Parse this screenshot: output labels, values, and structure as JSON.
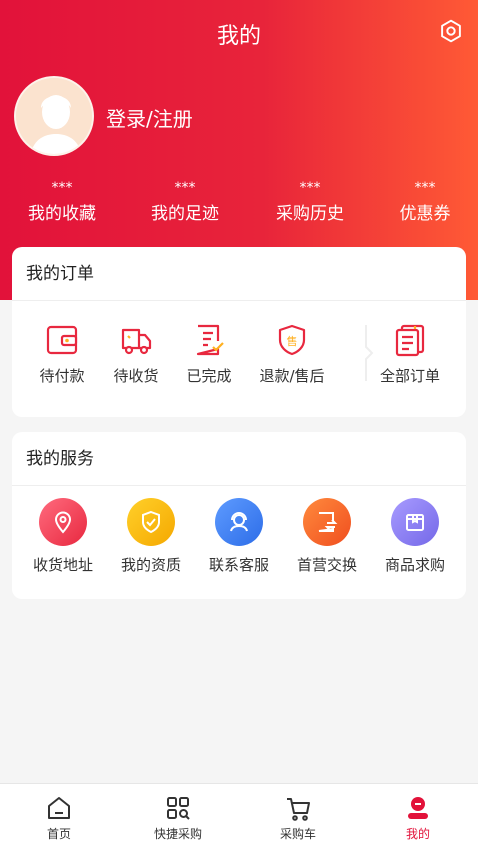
{
  "header": {
    "title": "我的",
    "login_label": "登录/注册"
  },
  "stats": [
    {
      "value": "***",
      "label": "我的收藏"
    },
    {
      "value": "***",
      "label": "我的足迹"
    },
    {
      "value": "***",
      "label": "采购历史"
    },
    {
      "value": "***",
      "label": "优惠券"
    }
  ],
  "orders": {
    "title": "我的订单",
    "items": [
      {
        "label": "待付款",
        "icon": "wallet-icon"
      },
      {
        "label": "待收货",
        "icon": "truck-icon"
      },
      {
        "label": "已完成",
        "icon": "completed-doc-icon"
      },
      {
        "label": "退款/售后",
        "icon": "after-sales-shield-icon"
      },
      {
        "label": "全部订单",
        "icon": "all-orders-icon"
      }
    ]
  },
  "services": {
    "title": "我的服务",
    "items": [
      {
        "label": "收货地址",
        "icon": "location-icon",
        "color": "#f2455c"
      },
      {
        "label": "我的资质",
        "icon": "shield-check-icon",
        "color": "#f5b400"
      },
      {
        "label": "联系客服",
        "icon": "customer-service-icon",
        "color": "#3d7cf2"
      },
      {
        "label": "首营交换",
        "icon": "exchange-doc-icon",
        "color": "#ff6a2b"
      },
      {
        "label": "商品求购",
        "icon": "box-icon",
        "color": "#8b7bf2"
      }
    ]
  },
  "tabbar": {
    "items": [
      {
        "label": "首页",
        "icon": "home-icon"
      },
      {
        "label": "快捷采购",
        "icon": "quick-purchase-icon"
      },
      {
        "label": "采购车",
        "icon": "cart-icon"
      },
      {
        "label": "我的",
        "icon": "profile-icon"
      }
    ],
    "active_color": "#e2123a"
  },
  "colors": {
    "brand_red": "#e2123a",
    "brand_orange": "#ff5a35"
  }
}
